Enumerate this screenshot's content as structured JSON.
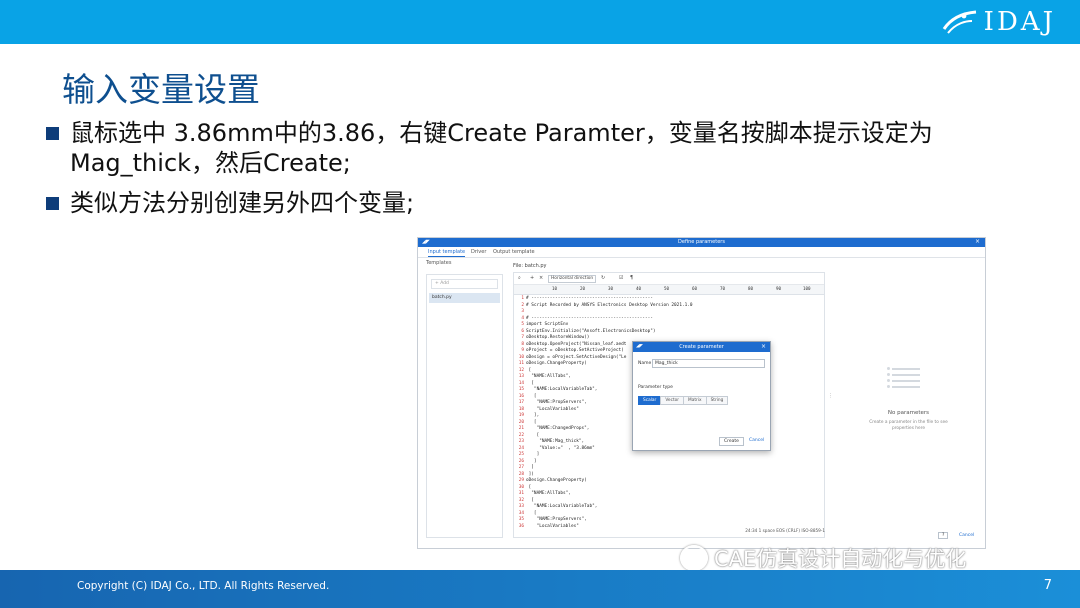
{
  "brand": {
    "logo_text": "IDAJ"
  },
  "slide": {
    "title": "输入变量设置",
    "bullets": [
      "鼠标选中 3.86mm中的3.86，右键Create Paramter，变量名按脚本提示设定为Mag_thick，然后Create;",
      "类似方法分别创建另外四个变量;"
    ]
  },
  "window": {
    "title": "Define parameters",
    "close_glyph": "×",
    "tabs": [
      "Input template",
      "Driver",
      "Output template"
    ],
    "templates_label": "Templates",
    "add_placeholder": "+ Add",
    "template_item": "batch.py",
    "file_label": "File:  batch.py",
    "toolbar": {
      "dropdown": "Horizontal direction"
    },
    "ruler": [
      "10",
      "20",
      "30",
      "40",
      "50",
      "60",
      "70",
      "80",
      "90",
      "100"
    ],
    "code_lines": [
      {
        "n": "1",
        "t": "# ----------------------------------------------"
      },
      {
        "n": "2",
        "t": "# Script Recorded by ANSYS Electronics Desktop Version 2021.1.0"
      },
      {
        "n": "3",
        "t": ""
      },
      {
        "n": "4",
        "t": "# ----------------------------------------------"
      },
      {
        "n": "5",
        "t": "import ScriptEnv"
      },
      {
        "n": "6",
        "t": "ScriptEnv.Initialize(\"Ansoft.ElectronicsDesktop\")"
      },
      {
        "n": "7",
        "t": "oDesktop.RestoreWindow()"
      },
      {
        "n": "8",
        "t": "oDesktop.OpenProject(\"Nissan_leaf.aedt"
      },
      {
        "n": "9",
        "t": "oProject = oDesktop.SetActiveProject("
      },
      {
        "n": "10",
        "t": "oDesign = oProject.SetActiveDesign(\"Le"
      },
      {
        "n": "11",
        "t": "oDesign.ChangeProperty("
      },
      {
        "n": "12",
        "t": " ["
      },
      {
        "n": "13",
        "t": "  \"NAME:AllTabs\","
      },
      {
        "n": "14",
        "t": "  ["
      },
      {
        "n": "15",
        "t": "   \"NAME:LocalVariableTab\","
      },
      {
        "n": "16",
        "t": "   ["
      },
      {
        "n": "17",
        "t": "    \"NAME:PropServers\","
      },
      {
        "n": "18",
        "t": "    \"LocalVariables\""
      },
      {
        "n": "19",
        "t": "   ],"
      },
      {
        "n": "20",
        "t": "   ["
      },
      {
        "n": "21",
        "t": "    \"NAME:ChangedProps\","
      },
      {
        "n": "22",
        "t": "    ["
      },
      {
        "n": "23",
        "t": "     \"NAME:Mag_thick\","
      },
      {
        "n": "24",
        "t": "     \"Value:=\"  , \"3.86mm\""
      },
      {
        "n": "25",
        "t": "    ]"
      },
      {
        "n": "26",
        "t": "   ]"
      },
      {
        "n": "27",
        "t": "  ]"
      },
      {
        "n": "28",
        "t": " ])"
      },
      {
        "n": "29",
        "t": "oDesign.ChangeProperty("
      },
      {
        "n": "30",
        "t": " ["
      },
      {
        "n": "31",
        "t": "  \"NAME:AllTabs\","
      },
      {
        "n": "32",
        "t": "  ["
      },
      {
        "n": "33",
        "t": "   \"NAME:LocalVariableTab\","
      },
      {
        "n": "34",
        "t": "   ["
      },
      {
        "n": "35",
        "t": "    \"NAME:PropServers\","
      },
      {
        "n": "36",
        "t": "    \"LocalVariables\""
      }
    ],
    "status": "24:34    1 space    EOS (CRLF)    ISO-8859-1",
    "no_params_title": "No parameters",
    "no_params_sub": "Create a parameter in the file to see properties here",
    "cancel_label": "Cancel",
    "ok_label": "?"
  },
  "dialog": {
    "title": "Create parameter",
    "name_label": "Name",
    "name_value": "Mag_thick",
    "type_label": "Parameter type",
    "types": [
      "Scalar",
      "Vector",
      "Matrix",
      "String"
    ],
    "active_type": "Scalar",
    "create_label": "Create",
    "cancel_label": "Cancel"
  },
  "watermark": "CAE仿真设计自动化与优化",
  "footer": {
    "copyright": "Copyright (C)  IDAJ Co., LTD. All Rights Reserved.",
    "page": "7"
  },
  "colors": {
    "accent": "#09a3e6",
    "title": "#0e4f8f",
    "window_blue": "#1e6ccf"
  }
}
